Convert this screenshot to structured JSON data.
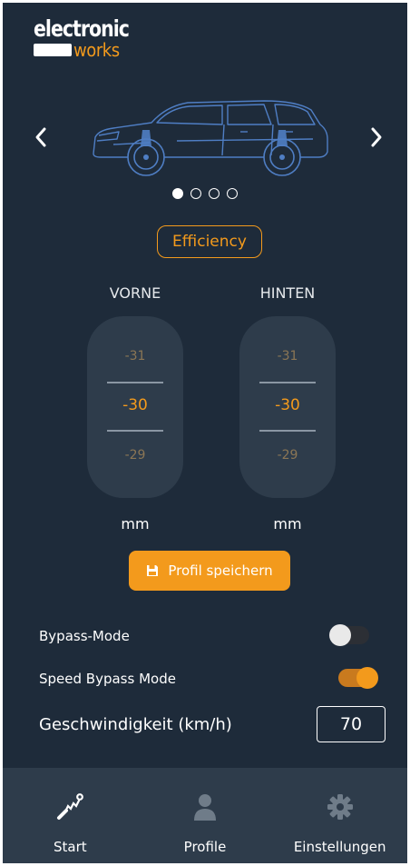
{
  "brand": {
    "line1": "electronic",
    "line2": "works"
  },
  "carousel": {
    "prev_icon": "chevron-left-icon",
    "next_icon": "chevron-right-icon",
    "page_count": 4,
    "active_index": 0
  },
  "mode": {
    "label": "Efficiency"
  },
  "front": {
    "label": "VORNE",
    "above": "-31",
    "value": "-30",
    "below": "-29",
    "unit": "mm"
  },
  "rear": {
    "label": "HINTEN",
    "above": "-31",
    "value": "-30",
    "below": "-29",
    "unit": "mm"
  },
  "save_button": {
    "label": "Profil speichern",
    "icon": "floppy-disk-icon"
  },
  "settings": {
    "bypass_mode": {
      "label": "Bypass-Mode",
      "enabled": false
    },
    "speed_bypass_mode": {
      "label": "Speed Bypass Mode",
      "enabled": true
    },
    "speed": {
      "label": "Geschwindigkeit (km/h)",
      "value": "70"
    }
  },
  "bottom_nav": [
    {
      "label": "Start",
      "icon": "shock-absorber-icon",
      "active": true
    },
    {
      "label": "Profile",
      "icon": "person-icon",
      "active": false
    },
    {
      "label": "Einstellungen",
      "icon": "gear-icon",
      "active": false
    }
  ],
  "colors": {
    "background": "#1e2b3a",
    "panel": "#2e3c4b",
    "accent": "#f39a1c",
    "text": "#ffffff",
    "inactive": "#7b8794"
  }
}
